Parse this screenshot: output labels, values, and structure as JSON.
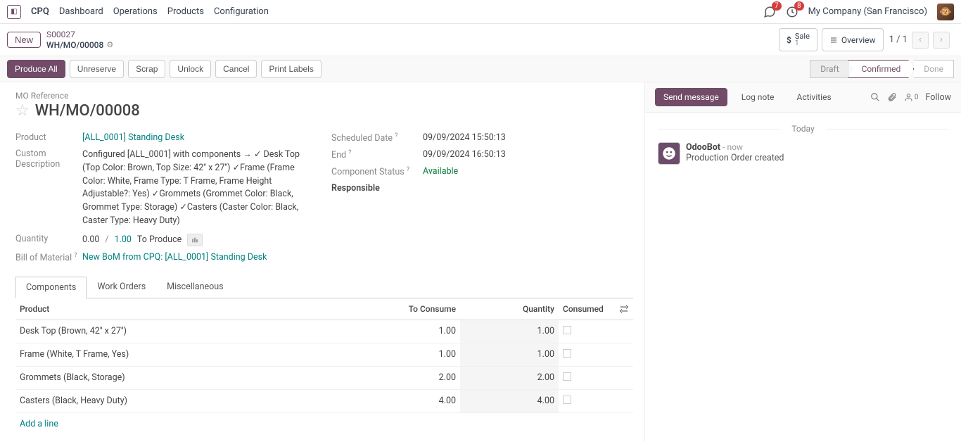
{
  "nav": {
    "app": "CPQ",
    "items": [
      "Dashboard",
      "Operations",
      "Products",
      "Configuration"
    ],
    "msg_badge": "7",
    "act_badge": "8",
    "company": "My Company (San Francisco)"
  },
  "breadcrumb": {
    "new_label": "New",
    "so": "S00027",
    "mo": "WH/MO/00008",
    "sale_label": "Sale",
    "sale_count": "1",
    "overview_label": "Overview",
    "pager": "1 / 1"
  },
  "status": {
    "produce_all": "Produce All",
    "unreserve": "Unreserve",
    "scrap": "Scrap",
    "unlock": "Unlock",
    "cancel": "Cancel",
    "print": "Print Labels",
    "draft": "Draft",
    "confirmed": "Confirmed",
    "done": "Done"
  },
  "form": {
    "ref_label": "MO Reference",
    "title": "WH/MO/00008",
    "product_label": "Product",
    "product_val": "[ALL_0001] Standing Desk",
    "custom_label": "Custom Description",
    "custom_val": "Configured [ALL_0001] with components → ✓ Desk Top (Top Color: Brown, Top Size: 42'' x 27'') ✓Frame (Frame Color: White, Frame Type: T Frame, Frame Height Adjustable?: Yes) ✓Grommets (Grommet Color: Black, Grommet Type: Storage) ✓Casters (Caster Color: Black, Caster Type: Heavy Duty)",
    "qty_label": "Quantity",
    "qty_done": "0.00",
    "qty_demand": "1.00",
    "to_produce": "To Produce",
    "bom_label": "Bill of Material",
    "bom_val": "New BoM from CPQ: [ALL_0001] Standing Desk",
    "sched_label": "Scheduled Date",
    "sched_val": "09/09/2024 15:50:13",
    "end_label": "End",
    "end_val": "09/09/2024 16:50:13",
    "comp_status_label": "Component Status",
    "comp_status_val": "Available",
    "resp_label": "Responsible",
    "q": "?"
  },
  "tabs": {
    "components": "Components",
    "work_orders": "Work Orders",
    "misc": "Miscellaneous"
  },
  "table": {
    "h_product": "Product",
    "h_to_consume": "To Consume",
    "h_quantity": "Quantity",
    "h_consumed": "Consumed",
    "add_line": "Add a line",
    "rows": [
      {
        "product": "Desk Top (Brown, 42'' x 27'')",
        "to_consume": "1.00",
        "quantity": "1.00"
      },
      {
        "product": "Frame (White, T Frame, Yes)",
        "to_consume": "1.00",
        "quantity": "1.00"
      },
      {
        "product": "Grommets (Black, Storage)",
        "to_consume": "2.00",
        "quantity": "2.00"
      },
      {
        "product": "Casters (Black, Heavy Duty)",
        "to_consume": "4.00",
        "quantity": "4.00"
      }
    ]
  },
  "chatter": {
    "send": "Send message",
    "log": "Log note",
    "activities": "Activities",
    "follow": "Follow",
    "follower_count": "0",
    "today": "Today",
    "author": "OdooBot",
    "time": "now",
    "body": "Production Order created"
  }
}
